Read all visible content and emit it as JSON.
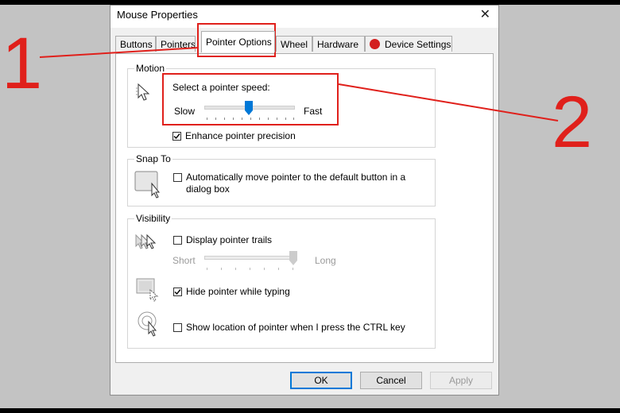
{
  "window": {
    "title": "Mouse Properties",
    "close_glyph": "✕"
  },
  "tabs": [
    {
      "label": "Buttons"
    },
    {
      "label": "Pointers"
    },
    {
      "label": "Pointer Options",
      "active": true
    },
    {
      "label": "Wheel"
    },
    {
      "label": "Hardware"
    },
    {
      "label": "Device Settings",
      "icon": "synaptics-icon"
    }
  ],
  "motion": {
    "group_label": "Motion",
    "speed_label": "Select a pointer speed:",
    "slow_label": "Slow",
    "fast_label": "Fast",
    "speed_value": 0.5,
    "enhance_precision": {
      "label": "Enhance pointer precision",
      "checked": true
    }
  },
  "snap_to": {
    "group_label": "Snap To",
    "auto_move": {
      "label_line1": "Automatically move pointer to the default button in a",
      "label_line2": "dialog box",
      "checked": false
    }
  },
  "visibility": {
    "group_label": "Visibility",
    "trails": {
      "label": "Display pointer trails",
      "checked": false
    },
    "short_label": "Short",
    "long_label": "Long",
    "trail_length_value": 1.0,
    "hide_typing": {
      "label": "Hide pointer while typing",
      "checked": true
    },
    "show_location": {
      "label": "Show location of pointer when I press the CTRL key",
      "checked": false
    }
  },
  "buttons": {
    "ok": "OK",
    "cancel": "Cancel",
    "apply": "Apply"
  },
  "annotations": {
    "number1": "1",
    "number2": "2",
    "color": "#e0201b"
  }
}
